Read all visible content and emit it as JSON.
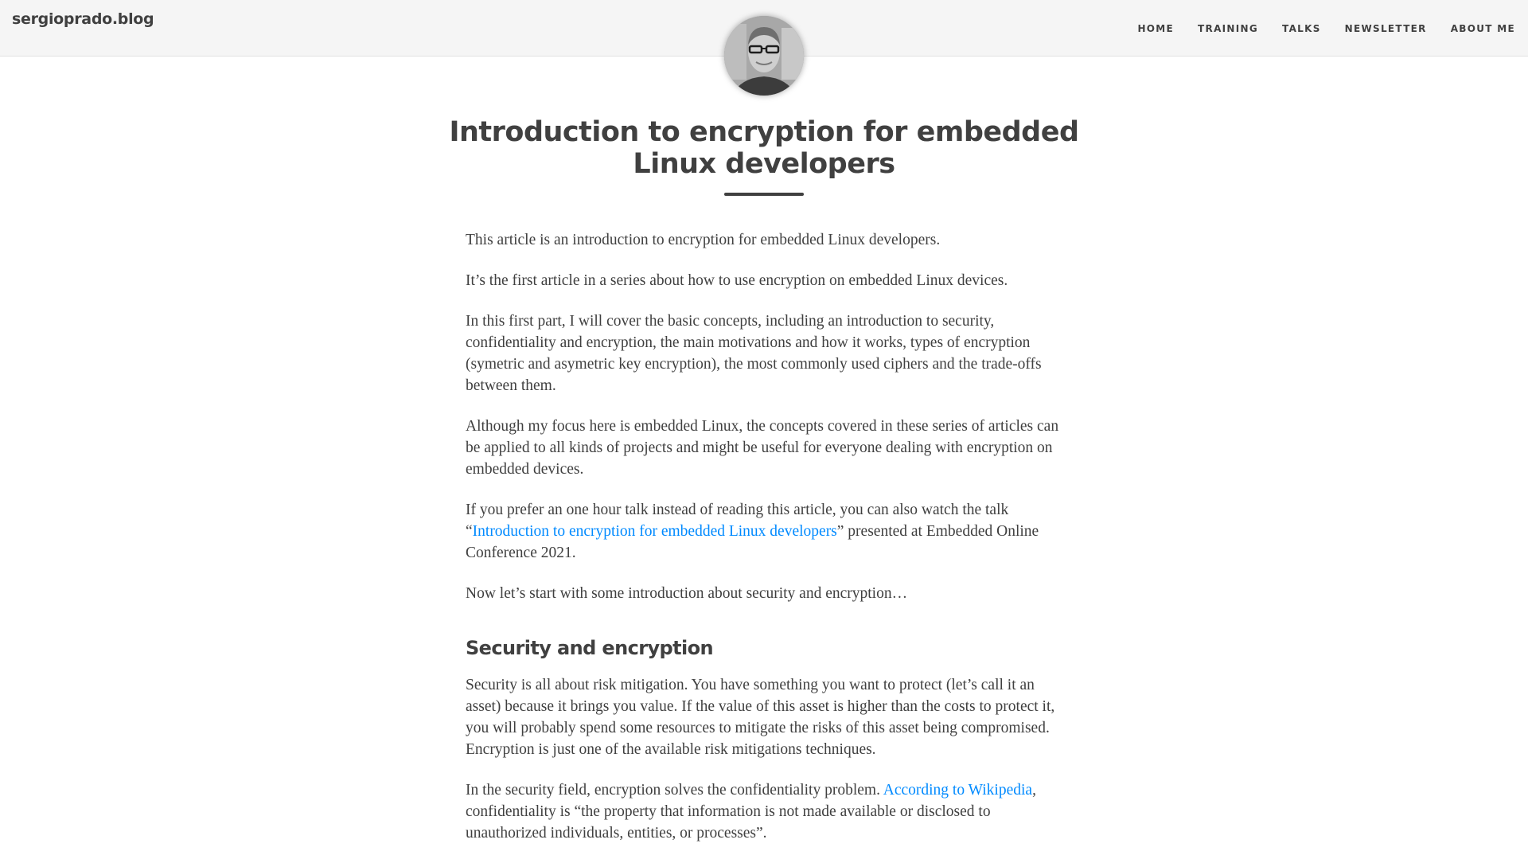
{
  "header": {
    "brand": "sergioprado.blog",
    "nav": [
      {
        "label": "Home"
      },
      {
        "label": "Training"
      },
      {
        "label": "Talks"
      },
      {
        "label": "Newsletter"
      },
      {
        "label": "About Me"
      }
    ]
  },
  "avatar": {
    "alt": "Author avatar"
  },
  "post": {
    "title": "Introduction to encryption for embedded Linux developers",
    "paragraphs_intro": [
      [
        {
          "text": "This article is an introduction to encryption for embedded Linux developers."
        }
      ],
      [
        {
          "text": "It’s the first article in a series about how to use encryption on embedded Linux devices."
        }
      ],
      [
        {
          "text": "In this first part, I will cover the basic concepts, including an introduction to security, confidentiality and encryption, the main motivations and how it works, types of encryption (symetric and asymetric key encryption), the most commonly used ciphers and the trade-offs between them."
        }
      ],
      [
        {
          "text": "Although my focus here is embedded Linux, the concepts covered in these series of articles can be applied to all kinds of projects and might be useful for everyone dealing with encryption on embedded devices."
        }
      ],
      [
        {
          "text": "If you prefer an one hour talk instead of reading this article, you can also watch the talk “"
        },
        {
          "text": "Introduction to encryption for embedded Linux developers",
          "link": true
        },
        {
          "text": "” presented at Embedded Online Conference 2021."
        }
      ],
      [
        {
          "text": "Now let’s start with some introduction about security and encryption…"
        }
      ]
    ],
    "section_heading": "Security and encryption",
    "paragraphs_section": [
      [
        {
          "text": "Security is all about risk mitigation. You have something you want to protect (let’s call it an asset) because it brings you value. If the value of this asset is higher than the costs to protect it, you will probably spend some resources to mitigate the risks of this asset being compromised. Encryption is just one of the available risk mitigations techniques."
        }
      ],
      [
        {
          "text": "In the security field, encryption solves the confidentiality problem. "
        },
        {
          "text": "According to Wikipedia",
          "link": true
        },
        {
          "text": ", confidentiality is “the property that information is not made available or disclosed to unauthorized individuals, entities, or processes”."
        }
      ]
    ]
  },
  "colors": {
    "text": "#404040",
    "link": "#008aff",
    "header_bg": "#f5f5f5"
  }
}
